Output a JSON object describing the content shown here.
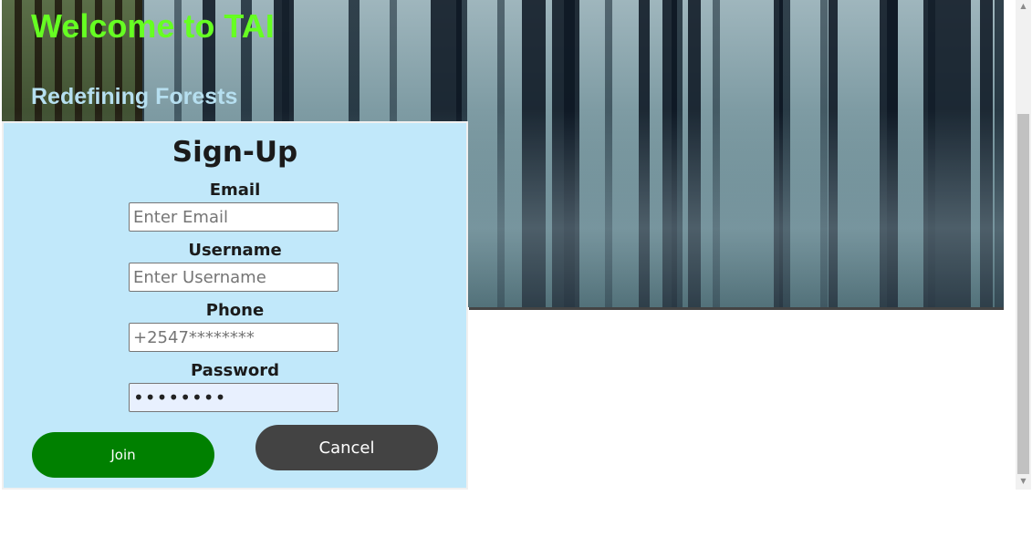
{
  "header": {
    "welcome": "Welcome to TAI",
    "tagline": "Redefining Forests"
  },
  "form": {
    "title": "Sign-Up",
    "email": {
      "label": "Email",
      "placeholder": "Enter Email",
      "value": ""
    },
    "username": {
      "label": "Username",
      "placeholder": "Enter Username",
      "value": ""
    },
    "phone": {
      "label": "Phone",
      "placeholder": "+2547********",
      "value": ""
    },
    "password": {
      "label": "Password",
      "placeholder": "",
      "value": "••••••••"
    },
    "join_label": "Join",
    "cancel_label": "Cancel"
  },
  "colors": {
    "welcome": "#66ff22",
    "tagline": "#b6dff0",
    "panel_bg": "#c1e8fa",
    "join_bg": "#008000",
    "cancel_bg": "#434343"
  },
  "icons": {
    "scroll_up": "chevron-up-icon",
    "scroll_down": "chevron-down-icon"
  }
}
